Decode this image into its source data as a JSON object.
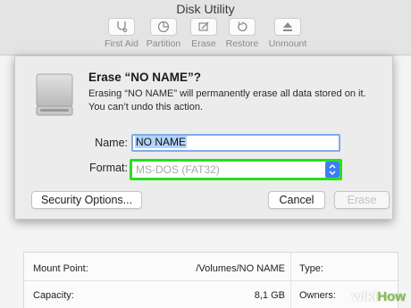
{
  "window": {
    "title": "Disk Utility"
  },
  "toolbar": {
    "items": [
      {
        "label": "First Aid",
        "icon": "stethoscope-icon"
      },
      {
        "label": "Partition",
        "icon": "pie-chart-icon"
      },
      {
        "label": "Erase",
        "icon": "pencil-eraser-icon"
      },
      {
        "label": "Restore",
        "icon": "restore-arrow-icon"
      },
      {
        "label": "Unmount",
        "icon": "eject-icon"
      }
    ]
  },
  "dialog": {
    "title": "Erase “NO NAME”?",
    "message": "Erasing “NO NAME” will permanently erase all data stored on it. You can’t undo this action.",
    "name_label": "Name:",
    "name_value": "NO NAME",
    "format_label": "Format:",
    "format_value": "MS-DOS (FAT32)",
    "security_button": "Security Options...",
    "cancel_button": "Cancel",
    "erase_button": "Erase",
    "highlight_color": "#26e01d",
    "accent_color": "#3b7ff2"
  },
  "info": {
    "rows": [
      {
        "key": "Mount Point:",
        "value": "/Volumes/NO NAME",
        "key2": "Type:"
      },
      {
        "key": "Capacity:",
        "value": "8,1 GB",
        "key2": "Owners:"
      }
    ]
  },
  "watermark": {
    "part1": "wiki",
    "part2": "How"
  }
}
